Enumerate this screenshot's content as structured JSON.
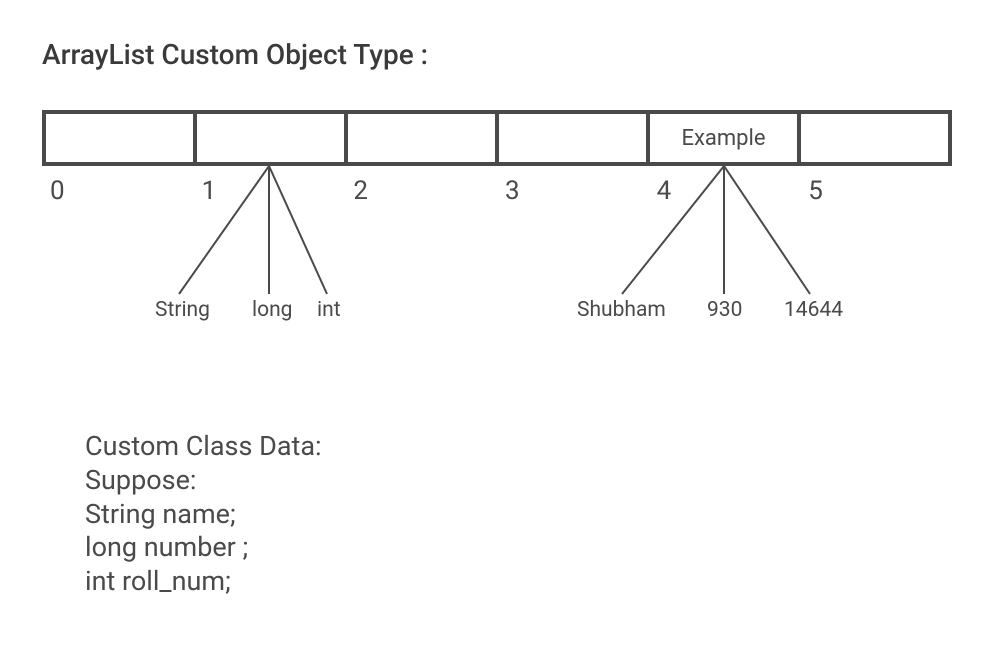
{
  "title": "ArrayList Custom Object Type :",
  "array": {
    "cells": [
      "",
      "",
      "",
      "",
      "Example",
      ""
    ],
    "indices": [
      "0",
      "1",
      "2",
      "3",
      "4",
      "5"
    ]
  },
  "branches": {
    "left": {
      "origin_index": 1,
      "labels": [
        "String",
        "long",
        "int"
      ]
    },
    "right": {
      "origin_index": 4,
      "labels": [
        "Shubham",
        "930",
        "14644"
      ]
    }
  },
  "class_data": {
    "line1": "Custom Class Data:",
    "line2": "Suppose:",
    "line3": "String name;",
    "line4": "long number ;",
    "line5": "int roll_num;"
  }
}
